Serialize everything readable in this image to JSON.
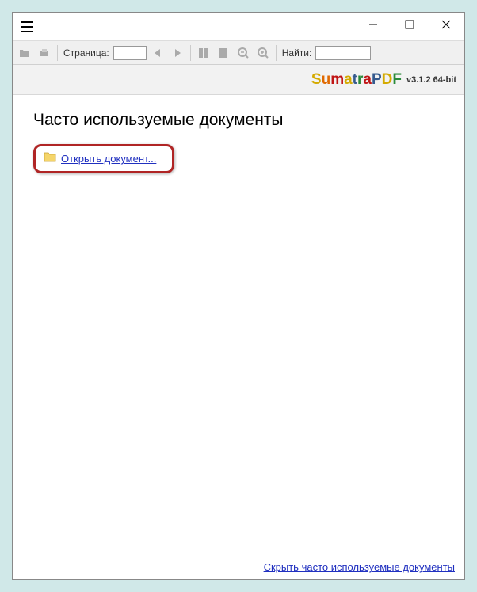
{
  "toolbar": {
    "page_label": "Страница:",
    "find_label": "Найти:",
    "page_value": "",
    "find_value": ""
  },
  "logo": {
    "s": "S",
    "u": "u",
    "m": "m",
    "a1": "a",
    "t": "t",
    "r": "r",
    "a2": "a",
    "p": "P",
    "d": "D",
    "f": "F"
  },
  "version": "v3.1.2 64-bit",
  "content": {
    "heading": "Часто используемые документы",
    "open_link": "Открыть документ...",
    "hide_link": "Скрыть часто используемые документы"
  }
}
